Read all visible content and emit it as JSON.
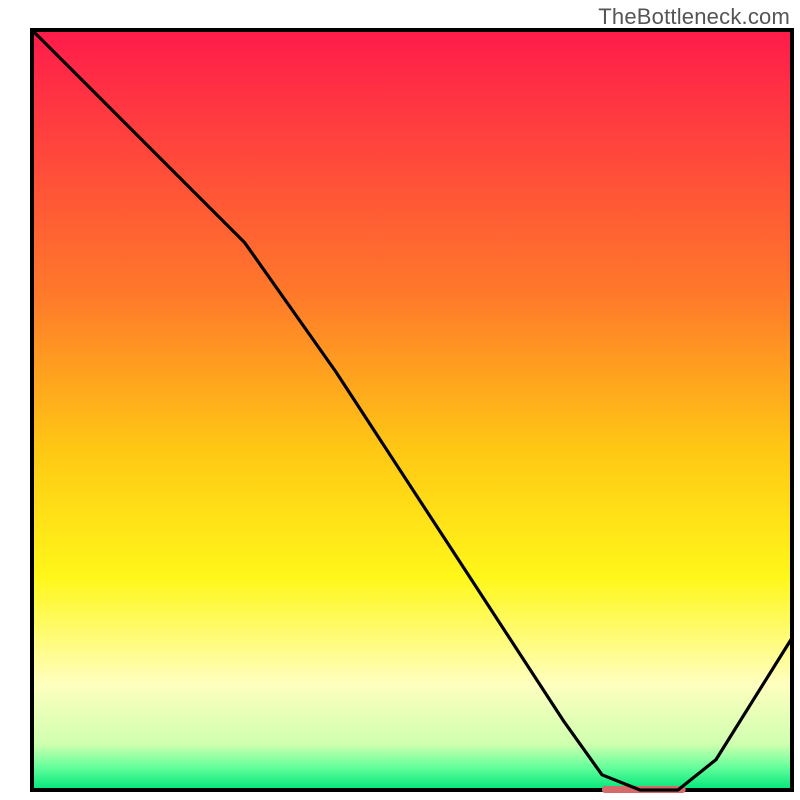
{
  "watermark": "TheBottleneck.com",
  "chart_data": {
    "type": "line",
    "title": "",
    "xlabel": "",
    "ylabel": "",
    "xlim": [
      0,
      100
    ],
    "ylim": [
      0,
      100
    ],
    "grid": false,
    "legend": false,
    "background_gradient_stops": [
      {
        "pct": 0,
        "color": "#ff1b4b"
      },
      {
        "pct": 35,
        "color": "#ff7a2a"
      },
      {
        "pct": 55,
        "color": "#ffc714"
      },
      {
        "pct": 72,
        "color": "#fff71a"
      },
      {
        "pct": 86,
        "color": "#ffffbe"
      },
      {
        "pct": 94,
        "color": "#cfffaf"
      },
      {
        "pct": 97,
        "color": "#65ff9b"
      },
      {
        "pct": 100,
        "color": "#00e57a"
      }
    ],
    "series": [
      {
        "name": "bottleneck-curve",
        "x": [
          0,
          8,
          20,
          28,
          40,
          55,
          70,
          75,
          80,
          85,
          90,
          100
        ],
        "y": [
          100,
          92,
          80,
          72,
          55,
          32,
          9,
          2,
          0,
          0,
          4,
          20
        ]
      }
    ],
    "marker": {
      "name": "optimal-range-marker",
      "x_start": 75,
      "x_end": 86,
      "y": 0,
      "color": "#d46a6a"
    },
    "axis_color": "#000000",
    "line_color": "#000000",
    "line_width": 3.2
  }
}
